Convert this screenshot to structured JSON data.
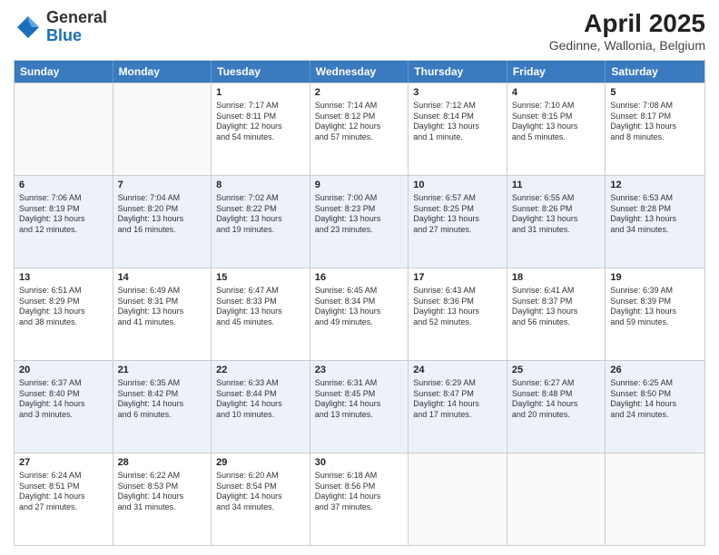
{
  "header": {
    "logo_general": "General",
    "logo_blue": "Blue",
    "main_title": "April 2025",
    "subtitle": "Gedinne, Wallonia, Belgium"
  },
  "calendar": {
    "days_of_week": [
      "Sunday",
      "Monday",
      "Tuesday",
      "Wednesday",
      "Thursday",
      "Friday",
      "Saturday"
    ],
    "rows": [
      {
        "alt": false,
        "cells": [
          {
            "day": "",
            "content": ""
          },
          {
            "day": "",
            "content": ""
          },
          {
            "day": "1",
            "content": "Sunrise: 7:17 AM\nSunset: 8:11 PM\nDaylight: 12 hours\nand 54 minutes."
          },
          {
            "day": "2",
            "content": "Sunrise: 7:14 AM\nSunset: 8:12 PM\nDaylight: 12 hours\nand 57 minutes."
          },
          {
            "day": "3",
            "content": "Sunrise: 7:12 AM\nSunset: 8:14 PM\nDaylight: 13 hours\nand 1 minute."
          },
          {
            "day": "4",
            "content": "Sunrise: 7:10 AM\nSunset: 8:15 PM\nDaylight: 13 hours\nand 5 minutes."
          },
          {
            "day": "5",
            "content": "Sunrise: 7:08 AM\nSunset: 8:17 PM\nDaylight: 13 hours\nand 8 minutes."
          }
        ]
      },
      {
        "alt": true,
        "cells": [
          {
            "day": "6",
            "content": "Sunrise: 7:06 AM\nSunset: 8:19 PM\nDaylight: 13 hours\nand 12 minutes."
          },
          {
            "day": "7",
            "content": "Sunrise: 7:04 AM\nSunset: 8:20 PM\nDaylight: 13 hours\nand 16 minutes."
          },
          {
            "day": "8",
            "content": "Sunrise: 7:02 AM\nSunset: 8:22 PM\nDaylight: 13 hours\nand 19 minutes."
          },
          {
            "day": "9",
            "content": "Sunrise: 7:00 AM\nSunset: 8:23 PM\nDaylight: 13 hours\nand 23 minutes."
          },
          {
            "day": "10",
            "content": "Sunrise: 6:57 AM\nSunset: 8:25 PM\nDaylight: 13 hours\nand 27 minutes."
          },
          {
            "day": "11",
            "content": "Sunrise: 6:55 AM\nSunset: 8:26 PM\nDaylight: 13 hours\nand 31 minutes."
          },
          {
            "day": "12",
            "content": "Sunrise: 6:53 AM\nSunset: 8:28 PM\nDaylight: 13 hours\nand 34 minutes."
          }
        ]
      },
      {
        "alt": false,
        "cells": [
          {
            "day": "13",
            "content": "Sunrise: 6:51 AM\nSunset: 8:29 PM\nDaylight: 13 hours\nand 38 minutes."
          },
          {
            "day": "14",
            "content": "Sunrise: 6:49 AM\nSunset: 8:31 PM\nDaylight: 13 hours\nand 41 minutes."
          },
          {
            "day": "15",
            "content": "Sunrise: 6:47 AM\nSunset: 8:33 PM\nDaylight: 13 hours\nand 45 minutes."
          },
          {
            "day": "16",
            "content": "Sunrise: 6:45 AM\nSunset: 8:34 PM\nDaylight: 13 hours\nand 49 minutes."
          },
          {
            "day": "17",
            "content": "Sunrise: 6:43 AM\nSunset: 8:36 PM\nDaylight: 13 hours\nand 52 minutes."
          },
          {
            "day": "18",
            "content": "Sunrise: 6:41 AM\nSunset: 8:37 PM\nDaylight: 13 hours\nand 56 minutes."
          },
          {
            "day": "19",
            "content": "Sunrise: 6:39 AM\nSunset: 8:39 PM\nDaylight: 13 hours\nand 59 minutes."
          }
        ]
      },
      {
        "alt": true,
        "cells": [
          {
            "day": "20",
            "content": "Sunrise: 6:37 AM\nSunset: 8:40 PM\nDaylight: 14 hours\nand 3 minutes."
          },
          {
            "day": "21",
            "content": "Sunrise: 6:35 AM\nSunset: 8:42 PM\nDaylight: 14 hours\nand 6 minutes."
          },
          {
            "day": "22",
            "content": "Sunrise: 6:33 AM\nSunset: 8:44 PM\nDaylight: 14 hours\nand 10 minutes."
          },
          {
            "day": "23",
            "content": "Sunrise: 6:31 AM\nSunset: 8:45 PM\nDaylight: 14 hours\nand 13 minutes."
          },
          {
            "day": "24",
            "content": "Sunrise: 6:29 AM\nSunset: 8:47 PM\nDaylight: 14 hours\nand 17 minutes."
          },
          {
            "day": "25",
            "content": "Sunrise: 6:27 AM\nSunset: 8:48 PM\nDaylight: 14 hours\nand 20 minutes."
          },
          {
            "day": "26",
            "content": "Sunrise: 6:25 AM\nSunset: 8:50 PM\nDaylight: 14 hours\nand 24 minutes."
          }
        ]
      },
      {
        "alt": false,
        "cells": [
          {
            "day": "27",
            "content": "Sunrise: 6:24 AM\nSunset: 8:51 PM\nDaylight: 14 hours\nand 27 minutes."
          },
          {
            "day": "28",
            "content": "Sunrise: 6:22 AM\nSunset: 8:53 PM\nDaylight: 14 hours\nand 31 minutes."
          },
          {
            "day": "29",
            "content": "Sunrise: 6:20 AM\nSunset: 8:54 PM\nDaylight: 14 hours\nand 34 minutes."
          },
          {
            "day": "30",
            "content": "Sunrise: 6:18 AM\nSunset: 8:56 PM\nDaylight: 14 hours\nand 37 minutes."
          },
          {
            "day": "",
            "content": ""
          },
          {
            "day": "",
            "content": ""
          },
          {
            "day": "",
            "content": ""
          }
        ]
      }
    ]
  }
}
